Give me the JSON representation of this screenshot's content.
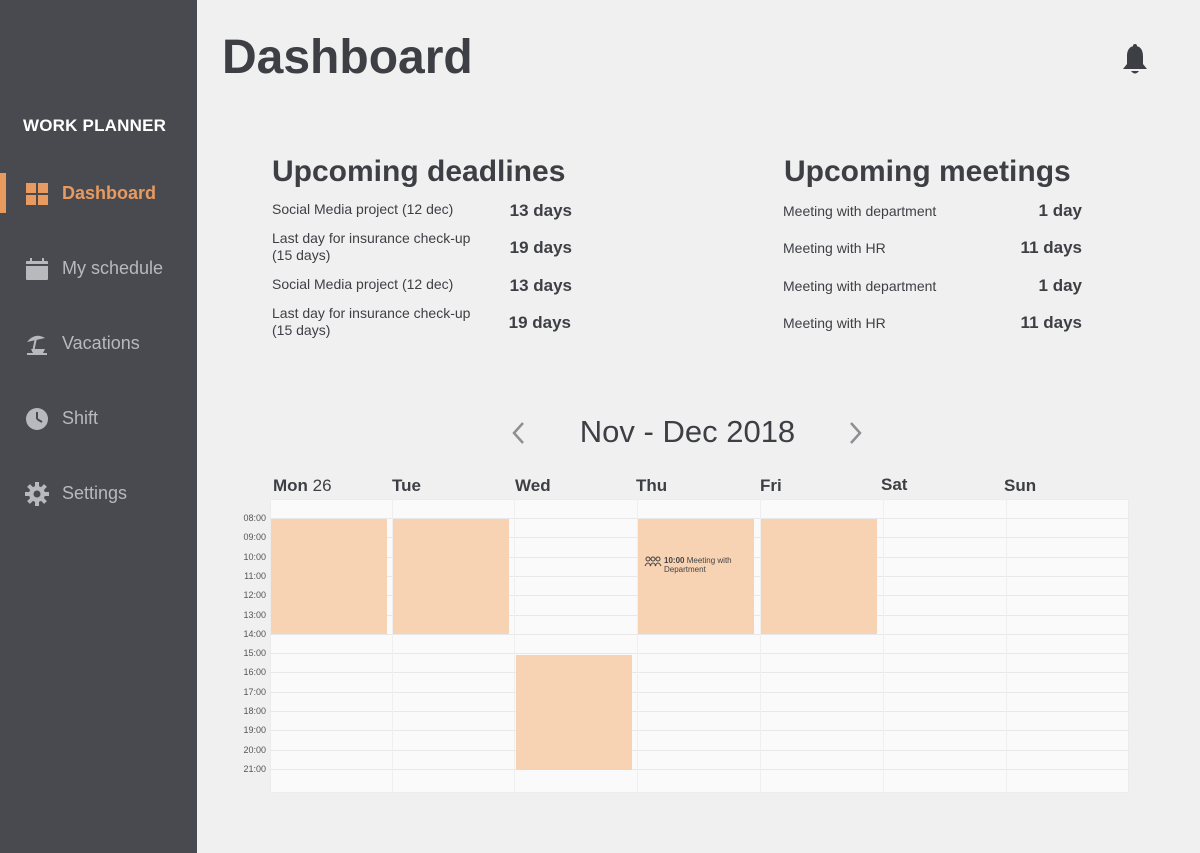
{
  "app": {
    "brand": "WORK PLANNER"
  },
  "sidebar": {
    "items": [
      {
        "label": "Dashboard",
        "icon": "dashboard-grid-icon"
      },
      {
        "label": "My schedule",
        "icon": "calendar-icon"
      },
      {
        "label": "Vacations",
        "icon": "beach-umbrella-icon"
      },
      {
        "label": "Shift",
        "icon": "clock-icon"
      },
      {
        "label": "Settings",
        "icon": "gear-icon"
      }
    ]
  },
  "header": {
    "title": "Dashboard",
    "bell_icon": "bell-icon"
  },
  "deadlines": {
    "title": "Upcoming deadlines",
    "rows": [
      {
        "label": "Social Media project (12 dec)",
        "value": "13 days"
      },
      {
        "label": "Last day for insurance check-up (15 days)",
        "value": "19 days"
      },
      {
        "label": "Social Media project (12 dec)",
        "value": "13 days"
      },
      {
        "label": "Last day for insurance check-up (15 days)",
        "value": "19 days"
      }
    ]
  },
  "meetings": {
    "title": "Upcoming meetings",
    "rows": [
      {
        "label": "Meeting with department",
        "value": "1 day"
      },
      {
        "label": "Meeting with HR",
        "value": "11 days"
      },
      {
        "label": "Meeting with department",
        "value": "1 day"
      },
      {
        "label": "Meeting with HR",
        "value": "11 days"
      }
    ]
  },
  "calendar": {
    "title": "Nov - Dec 2018",
    "days": [
      {
        "name": "Mon",
        "num": "26"
      },
      {
        "name": "Tue",
        "num": ""
      },
      {
        "name": "Wed",
        "num": ""
      },
      {
        "name": "Thu",
        "num": ""
      },
      {
        "name": "Fri",
        "num": ""
      },
      {
        "name": "Sat",
        "num": ""
      },
      {
        "name": "Sun",
        "num": ""
      }
    ],
    "times": [
      "08:00",
      "09:00",
      "10:00",
      "11:00",
      "12:00",
      "13:00",
      "14:00",
      "15:00",
      "16:00",
      "17:00",
      "18:00",
      "19:00",
      "20:00",
      "21:00"
    ],
    "event": {
      "time": "10:00",
      "text": "Meeting with Department"
    },
    "event_color": "#f7d2b3"
  },
  "colors": {
    "accent": "#e89a5f",
    "sidebar": "#494a4f"
  }
}
